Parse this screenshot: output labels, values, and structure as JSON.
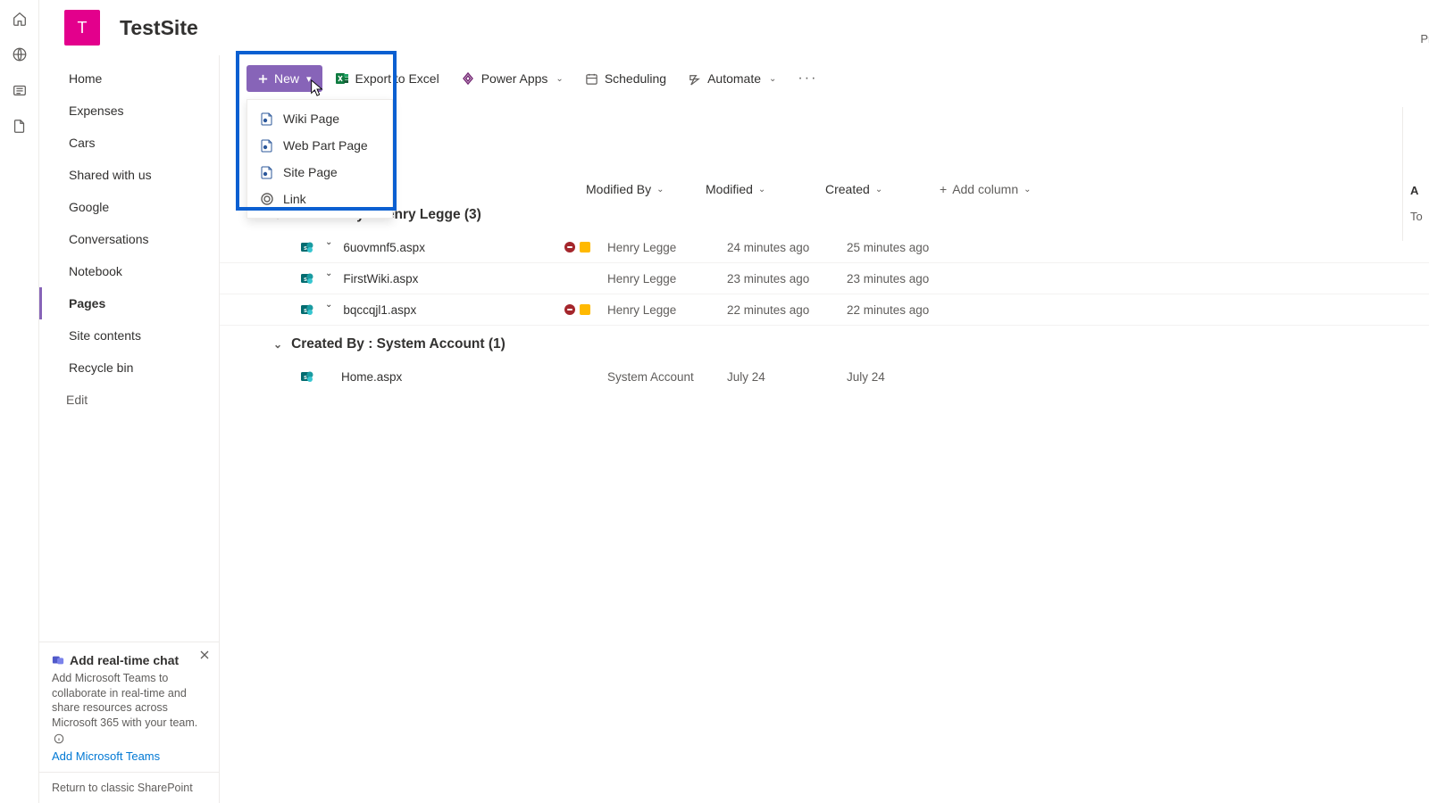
{
  "site": {
    "logo_letter": "T",
    "title": "TestSite",
    "privacy": "Priva"
  },
  "rail_icons": [
    "home",
    "globe",
    "news",
    "file"
  ],
  "nav": {
    "items": [
      {
        "label": "Home",
        "active": false
      },
      {
        "label": "Expenses",
        "active": false
      },
      {
        "label": "Cars",
        "active": false
      },
      {
        "label": "Shared with us",
        "active": false
      },
      {
        "label": "Google",
        "active": false
      },
      {
        "label": "Conversations",
        "active": false
      },
      {
        "label": "Notebook",
        "active": false
      },
      {
        "label": "Pages",
        "active": true
      },
      {
        "label": "Site contents",
        "active": false
      },
      {
        "label": "Recycle bin",
        "active": false
      }
    ],
    "edit": "Edit"
  },
  "chat_promo": {
    "title": "Add real-time chat",
    "desc": "Add Microsoft Teams to collaborate in real-time and share resources across Microsoft 365 with your team.",
    "link": "Add Microsoft Teams"
  },
  "classic_link": "Return to classic SharePoint",
  "toolbar": {
    "new_label": "New",
    "export_label": "Export to Excel",
    "powerapps_label": "Power Apps",
    "scheduling_label": "Scheduling",
    "automate_label": "Automate"
  },
  "new_menu": [
    {
      "label": "Wiki Page",
      "icon": "page"
    },
    {
      "label": "Web Part Page",
      "icon": "page"
    },
    {
      "label": "Site Page",
      "icon": "page"
    },
    {
      "label": "Link",
      "icon": "link"
    }
  ],
  "columns": {
    "modified_by": "Modified By",
    "modified": "Modified",
    "created": "Created",
    "add": "Add column"
  },
  "groups": [
    {
      "title": "Created By : Henry Legge (3)",
      "rows": [
        {
          "name": "6uovmnf5.aspx",
          "tilde": true,
          "badges": true,
          "modified_by": "Henry Legge",
          "modified": "24 minutes ago",
          "created": "25 minutes ago"
        },
        {
          "name": "FirstWiki.aspx",
          "tilde": true,
          "badges": false,
          "modified_by": "Henry Legge",
          "modified": "23 minutes ago",
          "created": "23 minutes ago"
        },
        {
          "name": "bqccqjl1.aspx",
          "tilde": true,
          "badges": true,
          "modified_by": "Henry Legge",
          "modified": "22 minutes ago",
          "created": "22 minutes ago"
        }
      ]
    },
    {
      "title": "Created By : System Account (1)",
      "rows": [
        {
          "name": "Home.aspx",
          "tilde": false,
          "badges": false,
          "modified_by": "System Account",
          "modified": "July 24",
          "created": "July 24"
        }
      ]
    }
  ],
  "details": {
    "label": "A",
    "value": "To"
  }
}
